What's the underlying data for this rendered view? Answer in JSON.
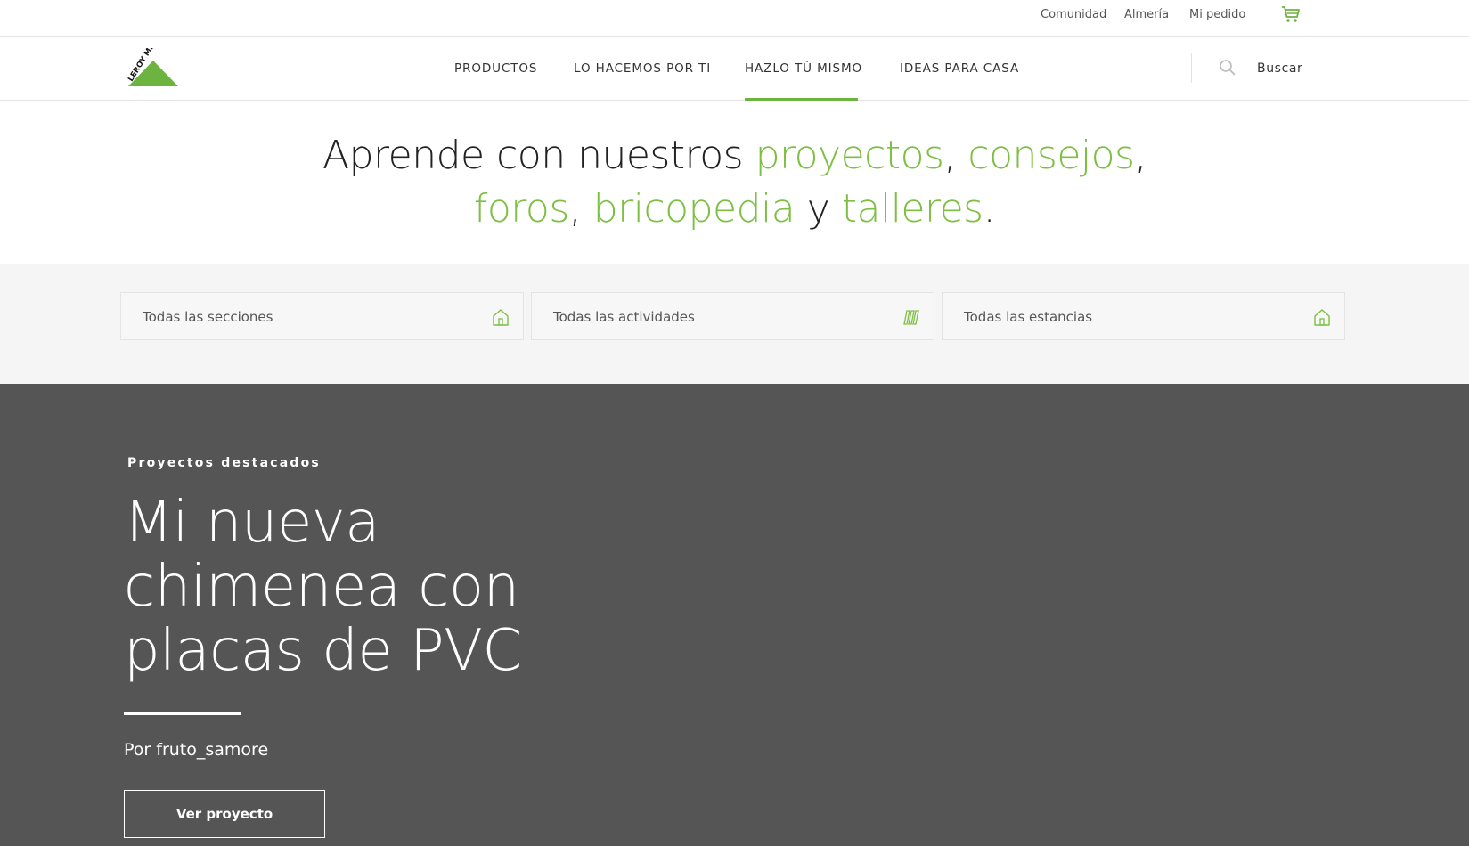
{
  "topbar": {
    "links": [
      "Comunidad",
      "Almería",
      "Mi pedido"
    ],
    "cart_icon": "cart-icon"
  },
  "header": {
    "logo_text": "LEROY MERLIN",
    "nav": [
      "PRODUCTOS",
      "LO HACEMOS POR TI",
      "HAZLO TÚ MISMO",
      "IDEAS PARA CASA"
    ],
    "active_nav": "HAZLO TÚ MISMO",
    "search_label": "Buscar",
    "search_icon": "search-icon"
  },
  "headline": {
    "line1_prefix": "Aprende con nuestros ",
    "proyectos": "proyectos",
    "comma1": ", ",
    "consejos": "consejos",
    "comma2": ",",
    "foros": "foros",
    "comma3": ", ",
    "bricopedia": "bricopedia",
    "y": " y ",
    "talleres": "talleres",
    "period": "."
  },
  "filters": [
    {
      "label": "Todas las secciones",
      "icon": "house-icon"
    },
    {
      "label": "Todas las actividades",
      "icon": "tools-icon"
    },
    {
      "label": "Todas las estancias",
      "icon": "house-icon"
    }
  ],
  "featured": {
    "eyebrow": "Proyectos destacados",
    "title": "Mi nueva chimenea con placas de PVC",
    "author": "Por fruto_samore",
    "cta": "Ver proyecto"
  },
  "colors": {
    "brand_green": "#7cbf42",
    "featured_bg": "#555555",
    "filters_bg": "#f5f5f5"
  }
}
